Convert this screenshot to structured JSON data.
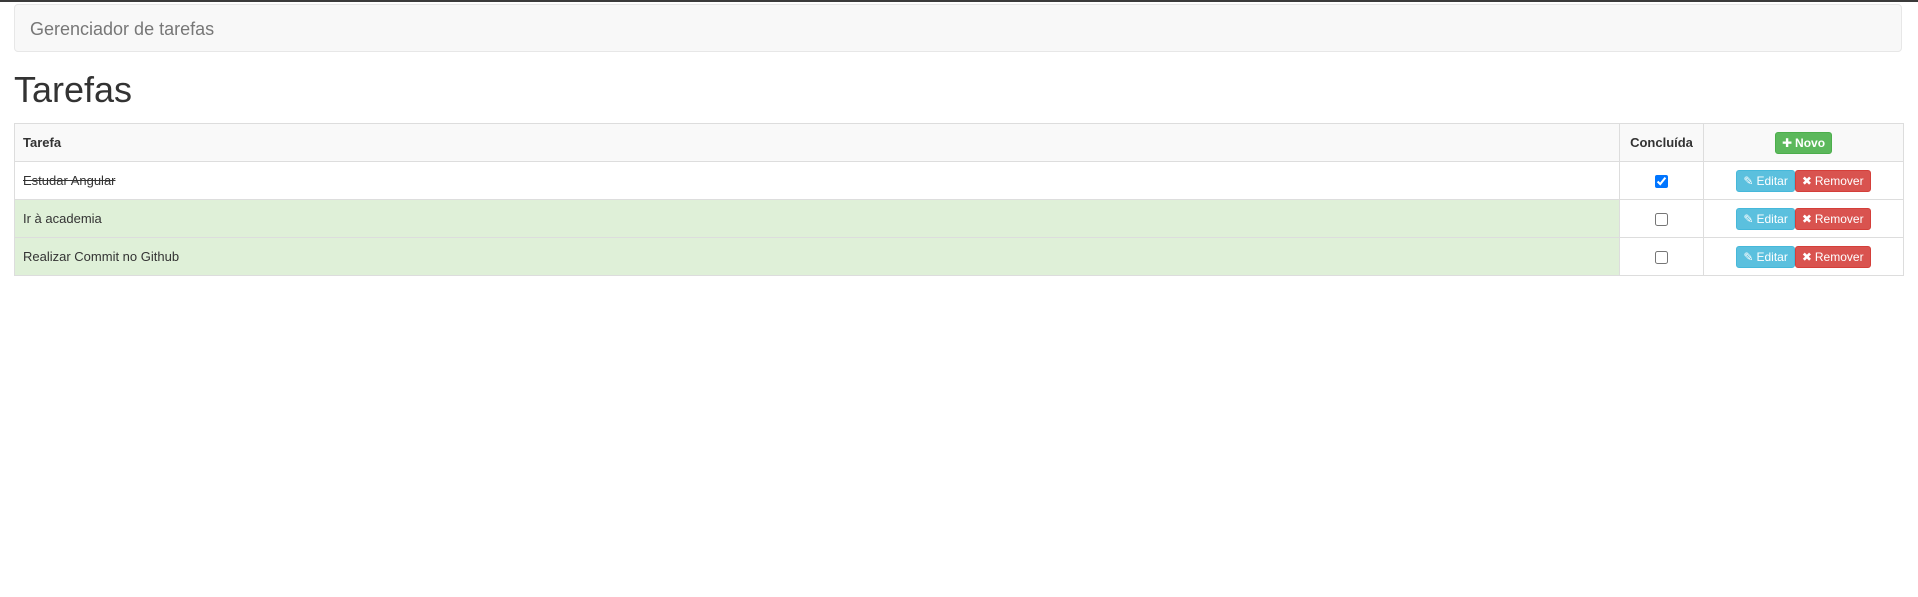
{
  "navbar": {
    "brand": "Gerenciador de tarefas"
  },
  "page": {
    "title": "Tarefas"
  },
  "table": {
    "headers": {
      "task": "Tarefa",
      "done": "Concluída",
      "new_button_label": "Novo",
      "new_button_icon": "plus-icon"
    },
    "rows": [
      {
        "name": "Estudar Angular",
        "done": true,
        "highlight": false
      },
      {
        "name": "Ir à academia",
        "done": false,
        "highlight": true
      },
      {
        "name": "Realizar Commit no Github",
        "done": false,
        "highlight": true
      }
    ],
    "actions": {
      "edit_label": "Editar",
      "edit_icon": "pencil-icon",
      "remove_label": "Remover",
      "remove_icon": "times-icon"
    }
  },
  "colors": {
    "success": "#5cb85c",
    "info": "#5bc0de",
    "danger": "#d9534f",
    "row_highlight": "#dff0d8"
  }
}
